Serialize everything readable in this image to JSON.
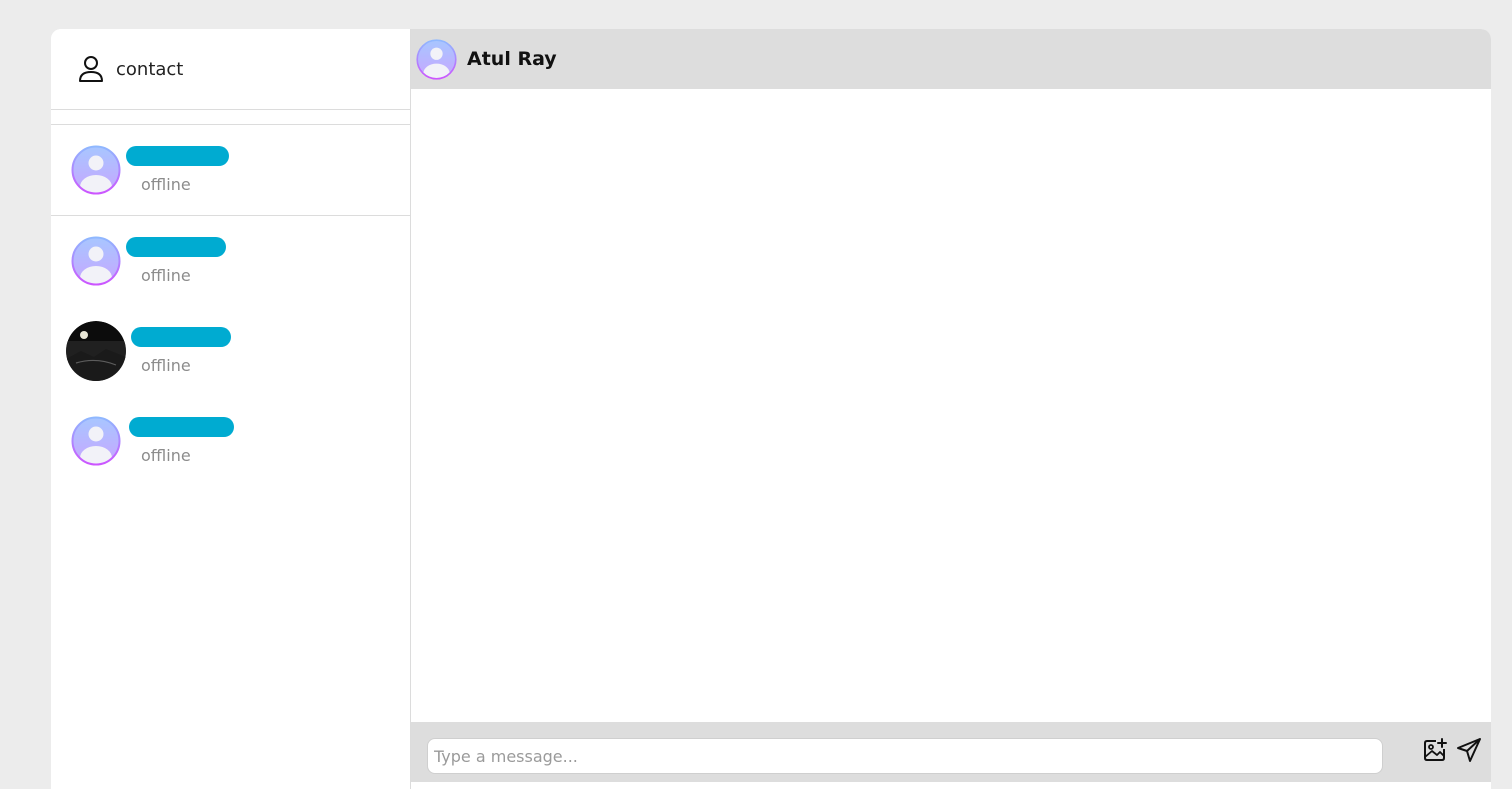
{
  "sidebar": {
    "header": {
      "title": "contact",
      "icon": "user-icon"
    },
    "contacts": [
      {
        "status": "offline",
        "avatar": "default-avatar",
        "name_redacted": true
      },
      {
        "status": "offline",
        "avatar": "default-avatar",
        "name_redacted": true
      },
      {
        "status": "offline",
        "avatar": "photo-avatar",
        "name_redacted": true
      },
      {
        "status": "offline",
        "avatar": "default-avatar",
        "name_redacted": true
      }
    ]
  },
  "chat": {
    "header": {
      "name": "Atul Ray",
      "avatar": "default-avatar"
    },
    "footer": {
      "placeholder": "Type a message...",
      "value": "",
      "image_button_icon": "image-add-icon",
      "send_button_icon": "send-icon"
    }
  },
  "colors": {
    "page_bg": "#ececec",
    "bar_bg": "#dddddd",
    "redaction": "#00abd1",
    "status_text": "#8c8c8c",
    "avatar_gradient_top": "#8fb8ff",
    "avatar_gradient_bottom": "#cc66ff"
  }
}
